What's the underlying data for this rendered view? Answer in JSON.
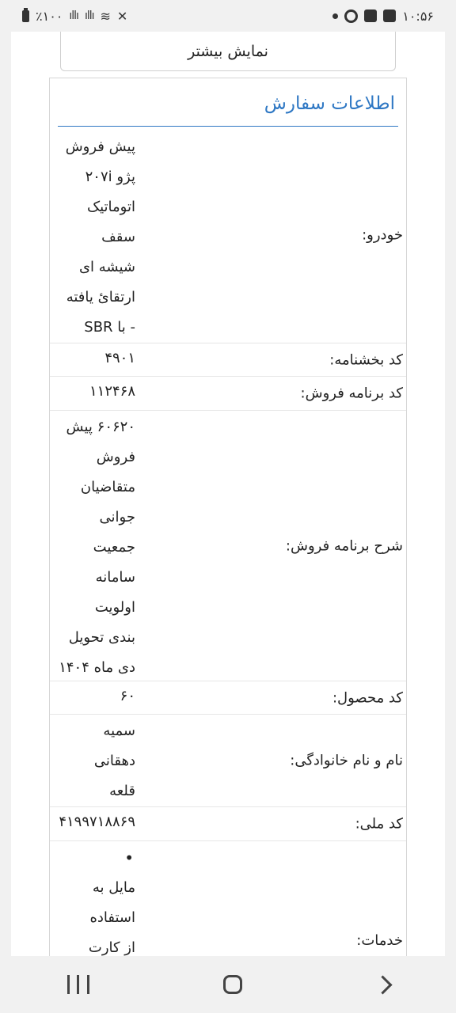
{
  "status_bar": {
    "battery": "٪۱۰۰",
    "time": "۱۰:۵۶"
  },
  "page": {
    "more_button": "نمایش بیشتر",
    "order_title": "اطلاعات سفارش",
    "rows": [
      {
        "label": "خودرو:",
        "lines": [
          "پیش فروش",
          "پژو ۲۰۷i",
          "اتوماتیک",
          "سقف",
          "شیشه ای",
          "ارتقائ یافته",
          "- با SBR"
        ]
      },
      {
        "label": "کد بخشنامه:",
        "lines": [
          "۴۹۰۱"
        ]
      },
      {
        "label": "کد برنامه فروش:",
        "lines": [
          "۱۱۲۴۶۸"
        ]
      },
      {
        "label": "شرح برنامه فروش:",
        "lines": [
          "۶۰۶۲۰ پیش",
          "فروش",
          "متقاضیان",
          "جوانی",
          "جمعیت",
          "سامانه",
          "اولویت",
          "بندی تحویل",
          "دی ماه ۱۴۰۴"
        ]
      },
      {
        "label": "کد محصول:",
        "lines": [
          "۶۰"
        ]
      },
      {
        "label": "نام و نام خانوادگی:",
        "lines": [
          "سمیه",
          "دهقانی",
          "قلعه"
        ]
      },
      {
        "label": "کد ملی:",
        "lines": [
          "۴۱۹۹۷۱۸۸۶۹"
        ]
      },
      {
        "label": "خدمات:",
        "lines": [
          "مایل به",
          "استفاده",
          "از کارت"
        ]
      }
    ]
  }
}
